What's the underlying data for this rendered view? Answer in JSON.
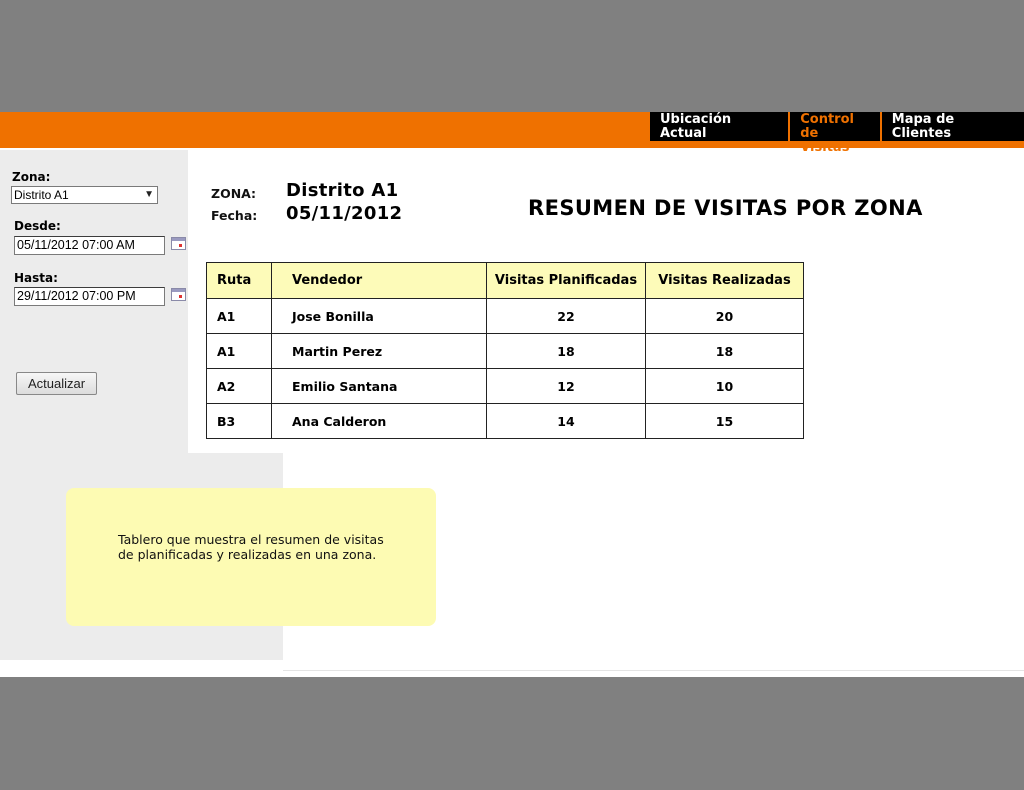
{
  "nav": {
    "items": [
      {
        "label": "Ubicación Actual"
      },
      {
        "label_line1": "Control",
        "label_line2": "de Visitas"
      },
      {
        "label": "Mapa de Clientes"
      }
    ]
  },
  "filters": {
    "zona_label": "Zona:",
    "zona_value": "Distrito A1",
    "desde_label": "Desde:",
    "desde_value": "05/11/2012 07:00 AM",
    "hasta_label": "Hasta:",
    "hasta_value": "29/11/2012 07:00 PM",
    "update_button": "Actualizar"
  },
  "header": {
    "zona_label": "ZONA:",
    "zona_value": "Distrito A1",
    "fecha_label": "Fecha:",
    "fecha_value": "05/11/2012",
    "title": "RESUMEN DE VISITAS POR ZONA"
  },
  "table": {
    "columns": [
      "Ruta",
      "Vendedor",
      "Visitas Planificadas",
      "Visitas Realizadas"
    ],
    "rows": [
      [
        "A1",
        "Jose Bonilla",
        "22",
        "20"
      ],
      [
        "A1",
        "Martin Perez",
        "18",
        "18"
      ],
      [
        "A2",
        "Emilio Santana",
        "12",
        "10"
      ],
      [
        "B3",
        "Ana Calderon",
        "14",
        "15"
      ]
    ]
  },
  "note": {
    "line1": "Tablero que muestra el resumen de visitas",
    "line2": "de planificadas y realizadas en una zona."
  },
  "colors": {
    "accent": "#ef7100",
    "nav_bg": "#000000",
    "table_header_bg": "#fdfbb9",
    "note_bg": "#fdfbb3",
    "sidebar_bg": "#ececec",
    "backdrop": "#808080"
  }
}
